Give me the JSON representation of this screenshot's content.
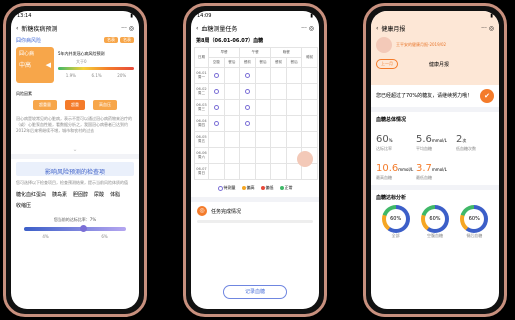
{
  "p1": {
    "status_time": "13:14",
    "nav_title": "新糖疾病预测",
    "prog_label": "囧你病风险",
    "tag1": "名表",
    "tag2": "名表",
    "card_title": "囧心病",
    "card_sub": "中高",
    "risk_title": "5年内并发冠心病风险预测",
    "pointer_label": "大于0",
    "scale": [
      "1.9%",
      "6.1%",
      "20%"
    ],
    "factor_label": "风险因素",
    "factors": [
      "超重量",
      "超重",
      "高血压"
    ],
    "para": "冠心病是较常见的心脏病，表示不是可以通过冠心病药物来治疗的（或）心脏泵血性能，看数据分析之，我国冠心病患者已达到约2012年后来将继续不增，城市和农村的过去",
    "check_title": "影响风险预测的检查项",
    "check_desc": "您可选择以下检查项目，检查预测结果，提示当前风险体质的值",
    "items": [
      "糖化血红蛋白",
      "胰岛素",
      "胆固醇",
      "尿酸",
      "体脂",
      "收缩压"
    ],
    "slider_title": "您当前的达标比率：7%",
    "slider_scale": [
      "4%",
      "6%"
    ],
    "slider_pct": 0.58
  },
  "p2": {
    "status_time": "14:09",
    "nav_title": "血糖测量任务",
    "week_title": "第8周（06.01-06.07）血糖",
    "cols": [
      "日期",
      "早餐",
      "午餐",
      "晚餐",
      "睡前"
    ],
    "subcols": [
      "空腹",
      "餐后",
      "餐前",
      "餐后",
      "餐前",
      "餐后"
    ],
    "rows": [
      [
        "06-01",
        "周一"
      ],
      [
        "06-02",
        "周二"
      ],
      [
        "06-03",
        "周三"
      ],
      [
        "06-04",
        "周四"
      ],
      [
        "06-05",
        "周五"
      ],
      [
        "06-06",
        "周六"
      ],
      [
        "06-07",
        "周日"
      ]
    ],
    "legend": [
      "待测量",
      "偏高",
      "偏低",
      "正常"
    ],
    "legend_colors": [
      "#7b6fd6",
      "#f5a623",
      "#e64a3b",
      "#3fb868"
    ],
    "task_title": "任务完成情况",
    "record_btn": "记录血糖"
  },
  "p3": {
    "status_time": "",
    "nav_title": "健康月报",
    "report_title": "王平安的健康月报-2019/02",
    "tab_left": "上一月",
    "tab_center": "健康月报",
    "encourage": "您已经超过了70%的糖友，请继续努力哦！",
    "stat_title": "血糖总体情况",
    "stats": [
      {
        "v": "60",
        "u": "%"
      },
      {
        "v": "5.6",
        "u": "mmol/L"
      },
      {
        "v": "2",
        "u": "次"
      },
      {
        "v": "10.6",
        "u": "mmol/L"
      },
      {
        "v": "3.7",
        "u": "mmol/L"
      }
    ],
    "stat_labels": [
      "达标比率",
      "平均血糖",
      "低血糖次数",
      "最高血糖",
      "最低血糖"
    ],
    "analysis_title": "血糖达标分析",
    "donuts": [
      "60%",
      "60%",
      "60%"
    ],
    "donut_labels": [
      "全部",
      "空腹血糖",
      "餐后血糖"
    ]
  }
}
